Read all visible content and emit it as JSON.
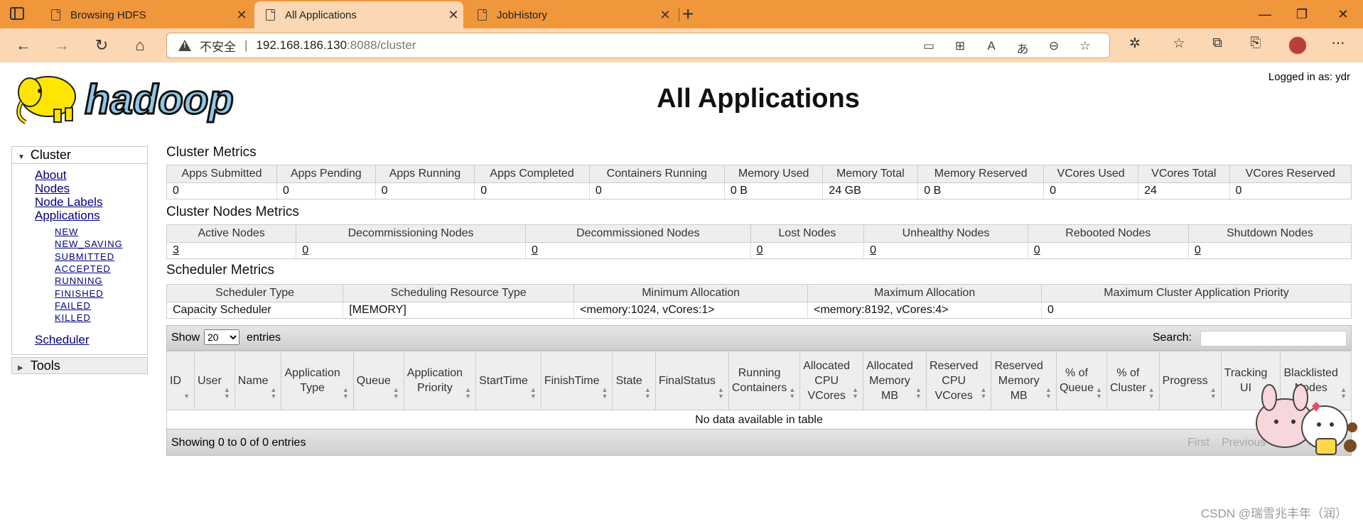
{
  "browser": {
    "tabs": [
      {
        "title": "Browsing HDFS",
        "active": false
      },
      {
        "title": "All Applications",
        "active": true
      },
      {
        "title": "JobHistory",
        "active": false
      }
    ],
    "new_tab": "+",
    "close_glyph": "✕",
    "address": {
      "insecure_label": "不安全",
      "separator": "|",
      "host": "192.168.186.130",
      "path": ":8088/cluster"
    },
    "accent": "#f0963b"
  },
  "page": {
    "logo_text": "hadoop",
    "logged_in": "Logged in as: ydr",
    "title": "All Applications"
  },
  "sidebar": {
    "cluster_label": "Cluster",
    "links": [
      "About",
      "Nodes",
      "Node Labels",
      "Applications"
    ],
    "states": [
      "NEW",
      "NEW_SAVING",
      "SUBMITTED",
      "ACCEPTED",
      "RUNNING",
      "FINISHED",
      "FAILED",
      "KILLED"
    ],
    "scheduler": "Scheduler",
    "tools_label": "Tools"
  },
  "cluster_metrics": {
    "title": "Cluster Metrics",
    "headers": [
      "Apps Submitted",
      "Apps Pending",
      "Apps Running",
      "Apps Completed",
      "Containers Running",
      "Memory Used",
      "Memory Total",
      "Memory Reserved",
      "VCores Used",
      "VCores Total",
      "VCores Reserved"
    ],
    "values": [
      "0",
      "0",
      "0",
      "0",
      "0",
      "0 B",
      "24 GB",
      "0 B",
      "0",
      "24",
      "0"
    ]
  },
  "nodes_metrics": {
    "title": "Cluster Nodes Metrics",
    "headers": [
      "Active Nodes",
      "Decommissioning Nodes",
      "Decommissioned Nodes",
      "Lost Nodes",
      "Unhealthy Nodes",
      "Rebooted Nodes",
      "Shutdown Nodes"
    ],
    "values": [
      "3",
      "0",
      "0",
      "0",
      "0",
      "0",
      "0"
    ]
  },
  "scheduler_metrics": {
    "title": "Scheduler Metrics",
    "headers": [
      "Scheduler Type",
      "Scheduling Resource Type",
      "Minimum Allocation",
      "Maximum Allocation",
      "Maximum Cluster Application Priority"
    ],
    "values": [
      "Capacity Scheduler",
      "[MEMORY]",
      "<memory:1024, vCores:1>",
      "<memory:8192, vCores:4>",
      "0"
    ]
  },
  "apps": {
    "show_label": "Show",
    "page_size": "20",
    "entries_label": "entries",
    "search_label": "Search:",
    "columns": [
      "ID",
      "User",
      "Name",
      "Application Type",
      "Queue",
      "Application Priority",
      "StartTime",
      "FinishTime",
      "State",
      "FinalStatus",
      "Running Containers",
      "Allocated CPU VCores",
      "Allocated Memory MB",
      "Reserved CPU VCores",
      "Reserved Memory MB",
      "% of Queue",
      "% of Cluster",
      "Progress",
      "Tracking UI",
      "Blacklisted Nodes"
    ],
    "empty_message": "No data available in table",
    "info": "Showing 0 to 0 of 0 entries",
    "first": "First",
    "previous": "Previous"
  },
  "watermark": "CSDN @瑞雪兆丰年（润）"
}
